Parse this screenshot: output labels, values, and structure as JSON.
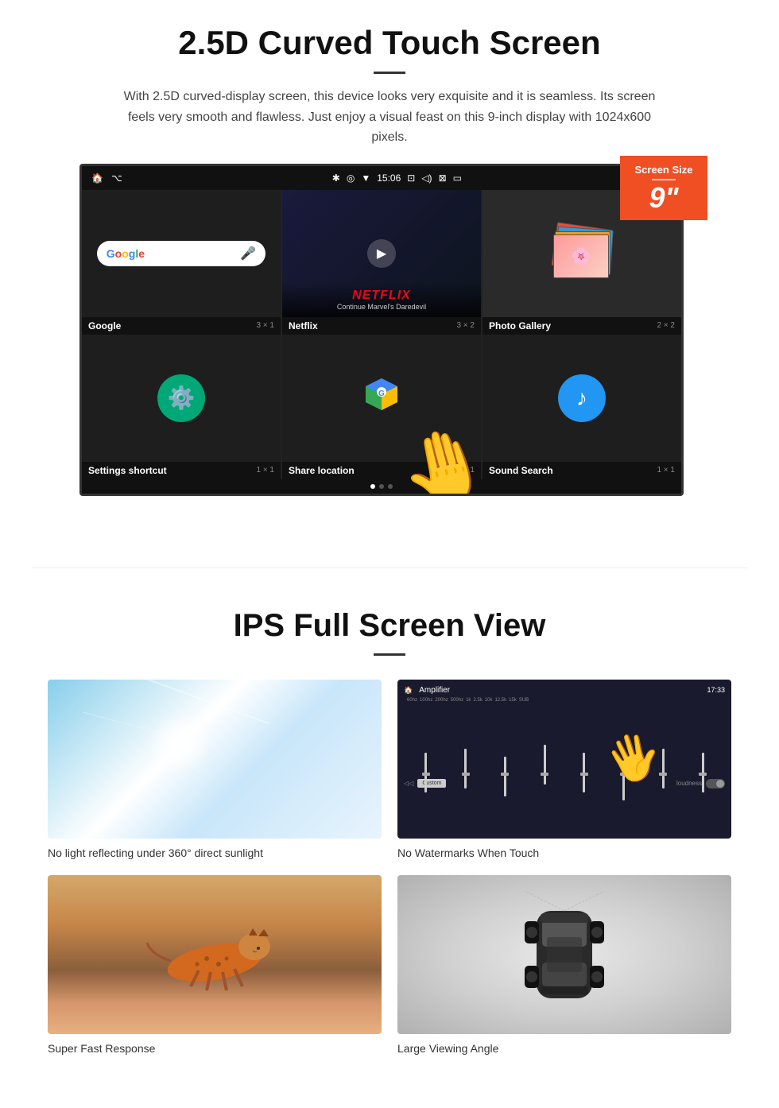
{
  "section1": {
    "title": "2.5D Curved Touch Screen",
    "description": "With 2.5D curved-display screen, this device looks very exquisite and it is seamless. Its screen feels very smooth and flawless. Just enjoy a visual feast on this 9-inch display with 1024x600 pixels.",
    "badge": {
      "label": "Screen Size",
      "size": "9\"",
      "divider": "—"
    },
    "status_bar": {
      "time": "15:06"
    },
    "apps_row1": [
      {
        "name": "Google",
        "size": "3 × 1"
      },
      {
        "name": "Netflix",
        "size": "3 × 2"
      },
      {
        "name": "Photo Gallery",
        "size": "2 × 2"
      }
    ],
    "apps_row2": [
      {
        "name": "Settings shortcut",
        "size": "1 × 1"
      },
      {
        "name": "Share location",
        "size": "1 × 1"
      },
      {
        "name": "Sound Search",
        "size": "1 × 1"
      }
    ],
    "netflix": {
      "logo": "NETFLIX",
      "subtitle": "Continue Marvel's Daredevil"
    }
  },
  "section2": {
    "title": "IPS Full Screen View",
    "features": [
      {
        "label": "No light reflecting under 360° direct sunlight",
        "type": "sky"
      },
      {
        "label": "No Watermarks When Touch",
        "type": "amplifier"
      },
      {
        "label": "Super Fast Response",
        "type": "cheetah"
      },
      {
        "label": "Large Viewing Angle",
        "type": "car"
      }
    ]
  }
}
